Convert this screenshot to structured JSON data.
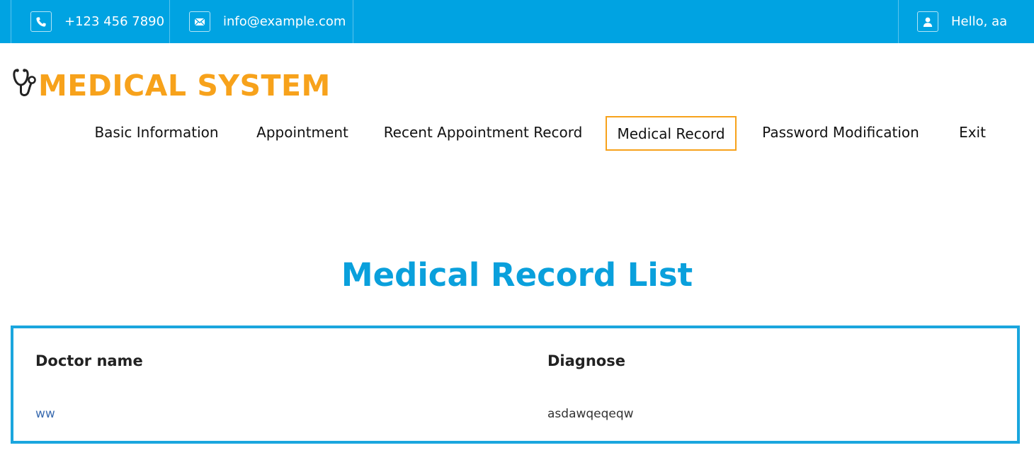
{
  "topbar": {
    "phone": "+123 456 7890",
    "email": "info@example.com",
    "greeting": "Hello, aa",
    "phone_icon": "phone-icon",
    "email_icon": "envelope-icon",
    "user_icon": "user-icon"
  },
  "brand": {
    "name": "MEDICAL SYSTEM",
    "icon": "stethoscope-icon"
  },
  "nav": {
    "items": [
      {
        "label": "Basic Information"
      },
      {
        "label": "Appointment"
      },
      {
        "label": "Recent Appointment Record"
      },
      {
        "label": "Medical Record"
      },
      {
        "label": "Password Modification"
      },
      {
        "label": "Exit"
      }
    ],
    "active": "Medical Record"
  },
  "main": {
    "title": "Medical Record List",
    "table": {
      "headers": [
        "Doctor name",
        "Diagnose"
      ],
      "rows": [
        {
          "doctor": "ww",
          "diagnose": "asdawqeqeqw"
        }
      ]
    }
  },
  "colors": {
    "topbar": "#00a3e2",
    "brand": "#f7a21b",
    "title": "#0aa0dc",
    "box_border": "#1aa6de",
    "active_border": "#f7a21b",
    "link": "#3b6cb0"
  }
}
